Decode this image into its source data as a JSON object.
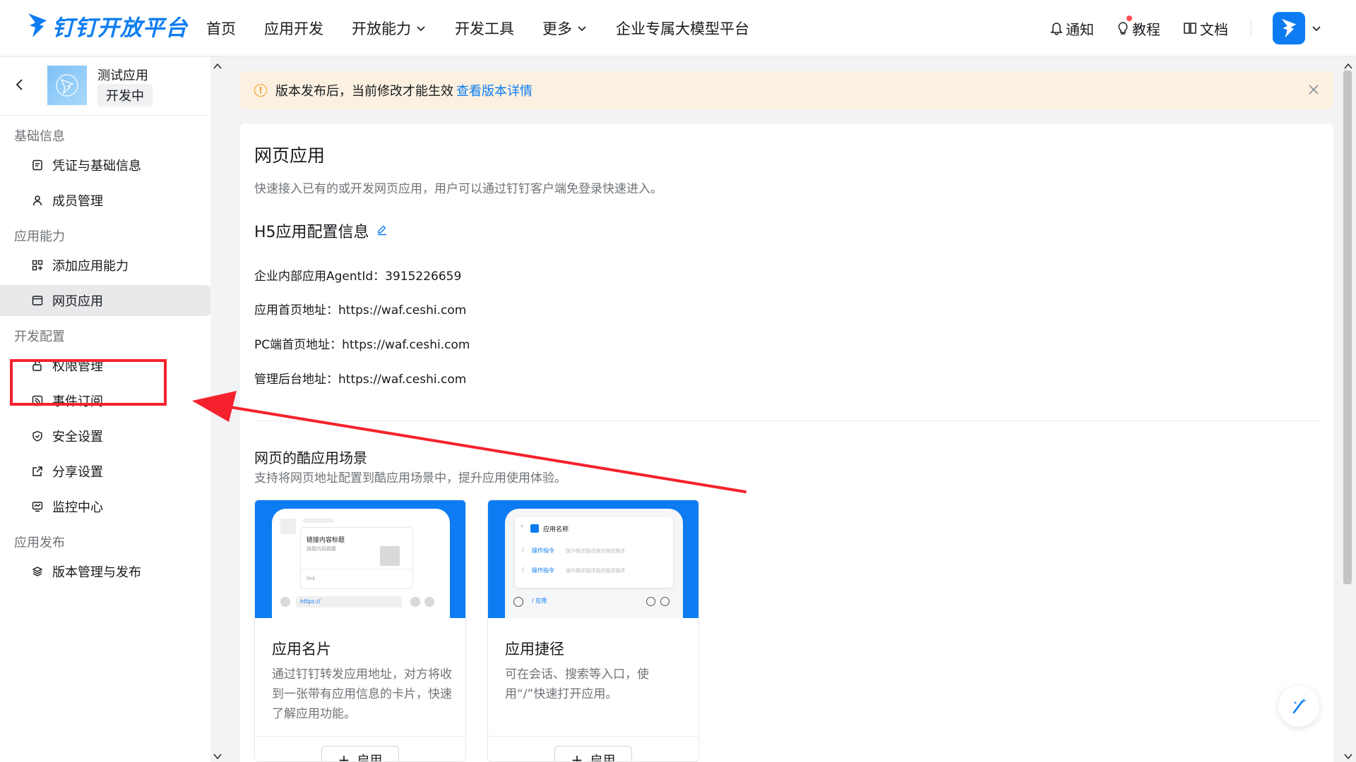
{
  "brand": {
    "name": "钉钉开放平台",
    "accent": "#0d7cf2"
  },
  "nav": {
    "items": [
      {
        "label": "首页",
        "dropdown": false
      },
      {
        "label": "应用开发",
        "dropdown": false
      },
      {
        "label": "开放能力",
        "dropdown": true
      },
      {
        "label": "开发工具",
        "dropdown": false
      },
      {
        "label": "更多",
        "dropdown": true
      },
      {
        "label": "企业专属大模型平台",
        "dropdown": false
      }
    ],
    "notice": "通知",
    "tutorial": "教程",
    "docs": "文档"
  },
  "app": {
    "name": "测试应用",
    "status": "开发中"
  },
  "sidebar": {
    "groups": [
      {
        "title": "基础信息",
        "items": [
          {
            "label": "凭证与基础信息",
            "icon": "credential-icon"
          },
          {
            "label": "成员管理",
            "icon": "user-icon"
          }
        ]
      },
      {
        "title": "应用能力",
        "items": [
          {
            "label": "添加应用能力",
            "icon": "grid-plus-icon"
          },
          {
            "label": "网页应用",
            "icon": "browser-icon",
            "active": true
          }
        ]
      },
      {
        "title": "开发配置",
        "items": [
          {
            "label": "权限管理",
            "icon": "lock-icon"
          },
          {
            "label": "事件订阅",
            "icon": "rss-icon"
          },
          {
            "label": "安全设置",
            "icon": "shield-icon"
          },
          {
            "label": "分享设置",
            "icon": "share-icon"
          },
          {
            "label": "监控中心",
            "icon": "monitor-icon"
          }
        ]
      },
      {
        "title": "应用发布",
        "items": [
          {
            "label": "版本管理与发布",
            "icon": "layers-icon"
          }
        ]
      }
    ]
  },
  "banner": {
    "text": "版本发布后，当前修改才能生效",
    "link": "查看版本详情"
  },
  "page": {
    "title": "网页应用",
    "desc": "快速接入已有的或开发网页应用，用户可以通过钉钉客户端免登录快速进入。",
    "section_title": "H5应用配置信息",
    "info": [
      "企业内部应用AgentId：3915226659",
      "应用首页地址：https://waf.ceshi.com",
      "PC端首页地址：https://waf.ceshi.com",
      "管理后台地址：https://waf.ceshi.com"
    ],
    "scene_title": "网页的酷应用场景",
    "scene_desc": "支持将网页地址配置到酷应用场景中，提升应用使用体验。"
  },
  "scenes": [
    {
      "name": "应用名片",
      "desc": "通过钉钉转发应用地址，对方将收到一张带有应用信息的卡片，快速了解应用功能。",
      "button": "启用",
      "mock": {
        "title": "链接内容标题",
        "subtitle": "链接内容摘要",
        "link": "link",
        "input": "https://"
      }
    },
    {
      "name": "应用捷径",
      "desc": "可在会话、搜索等入口，使用“/”快速打开应用。",
      "button": "启用",
      "mock": {
        "title": "应用名称",
        "cmd1": "操作指令",
        "cmd1_desc": "操作描述描述描述描述描述",
        "cmd2": "操作指令",
        "cmd2_desc": "操作描述描述描述描述描述",
        "input": "/ 应用"
      }
    }
  ]
}
